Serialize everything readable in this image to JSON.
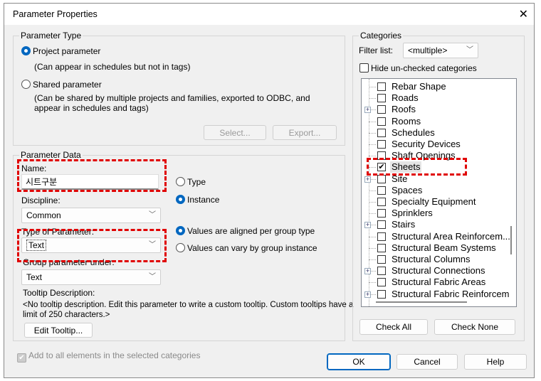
{
  "window": {
    "title": "Parameter Properties",
    "close_icon": "close-icon"
  },
  "parameter_type": {
    "label": "Parameter Type",
    "project": {
      "label": "Project parameter",
      "desc": "(Can appear in schedules but not in tags)",
      "selected": true
    },
    "shared": {
      "label": "Shared parameter",
      "desc1": "(Can be shared by multiple projects and families, exported to ODBC, and",
      "desc2": "appear in schedules and tags)",
      "selected": false
    },
    "select_button": "Select...",
    "export_button": "Export..."
  },
  "parameter_data": {
    "label": "Parameter Data",
    "name_label": "Name:",
    "name_value": "시트구분",
    "discipline_label": "Discipline:",
    "discipline_value": "Common",
    "type_of_parameter_label": "Type of Parameter:",
    "type_of_parameter_value": "Text",
    "group_label": "Group parameter under:",
    "group_value": "Text",
    "type_radio": "Type",
    "instance_radio": "Instance",
    "instance_selected": true,
    "aligned_radio": "Values are aligned per group type",
    "vary_radio": "Values can vary by group instance",
    "aligned_selected": true,
    "tooltip_label": "Tooltip Description:",
    "tooltip_text1": "<No tooltip description. Edit this parameter to write a custom tooltip. Custom tooltips have a",
    "tooltip_text2": "limit of 250 characters.>",
    "edit_tooltip_button": "Edit Tooltip..."
  },
  "categories": {
    "label": "Categories",
    "filter_label": "Filter list:",
    "filter_value": "<multiple>",
    "hide_unchecked": "Hide un-checked categories",
    "items": [
      {
        "label": "Rebar Shape",
        "checked": false,
        "expandable": false
      },
      {
        "label": "Roads",
        "checked": false,
        "expandable": false
      },
      {
        "label": "Roofs",
        "checked": false,
        "expandable": true
      },
      {
        "label": "Rooms",
        "checked": false,
        "expandable": false
      },
      {
        "label": "Schedules",
        "checked": false,
        "expandable": false
      },
      {
        "label": "Security Devices",
        "checked": false,
        "expandable": false
      },
      {
        "label": "Shaft Openings",
        "checked": false,
        "expandable": false
      },
      {
        "label": "Sheets",
        "checked": true,
        "expandable": false
      },
      {
        "label": "Site",
        "checked": false,
        "expandable": true
      },
      {
        "label": "Spaces",
        "checked": false,
        "expandable": false
      },
      {
        "label": "Specialty Equipment",
        "checked": false,
        "expandable": false
      },
      {
        "label": "Sprinklers",
        "checked": false,
        "expandable": false
      },
      {
        "label": "Stairs",
        "checked": false,
        "expandable": true
      },
      {
        "label": "Structural Area Reinforcem...",
        "checked": false,
        "expandable": false
      },
      {
        "label": "Structural Beam Systems",
        "checked": false,
        "expandable": false
      },
      {
        "label": "Structural Columns",
        "checked": false,
        "expandable": false
      },
      {
        "label": "Structural Connections",
        "checked": false,
        "expandable": true
      },
      {
        "label": "Structural Fabric Areas",
        "checked": false,
        "expandable": false
      },
      {
        "label": "Structural Fabric Reinforcem",
        "checked": false,
        "expandable": true
      }
    ],
    "check_all": "Check All",
    "check_none": "Check None"
  },
  "footer": {
    "add_to_all": "Add to all elements in the selected categories",
    "ok": "OK",
    "cancel": "Cancel",
    "help": "Help"
  },
  "colors": {
    "accent": "#0067c0",
    "highlight": "#e00000"
  }
}
